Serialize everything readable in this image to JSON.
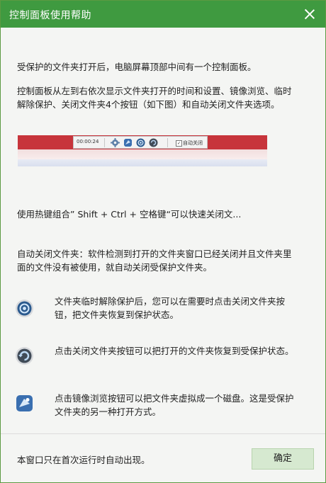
{
  "window": {
    "title": "控制面板使用帮助"
  },
  "content": {
    "intro": "受保护的文件夹打开后，电脑屏幕顶部中间有一个控制面板。",
    "panel_desc_line1": "控制面板从左到右依次显示文件夹打开的时间和设置、镜像浏览、临时",
    "panel_desc_line2": "解除保护、关闭文件夹4个按钮（如下图）和自动关闭文件夹选项。",
    "preview": {
      "time": "00:00:24",
      "checkbox_checked": true,
      "checkbox_label": "自动关闭"
    },
    "hotkey": "使用热键组合” Shift + Ctrl + 空格键“可以快速关闭文...",
    "autoclose_line1": "自动关闭文件夹：软件检测到打开的文件夹窗口已经关闭并且文件夹里",
    "autoclose_line2": "面的文件没有被使用，就自动关闭受保护文件夹。",
    "items": [
      {
        "icon": "unprotect-icon",
        "line1": "文件夹临时解除保护后，您可以在需要时点击关闭文件夹按",
        "line2": "钮，把文件夹恢复到保护状态。"
      },
      {
        "icon": "close-folder-icon",
        "line1": "点击关闭文件夹按钮可以把打开的文件夹恢复到受保护状态。",
        "line2": ""
      },
      {
        "icon": "mirror-browse-icon",
        "line1": "点击镜像浏览按钮可以把文件夹虚拟成一个磁盘。这是受保护",
        "line2": "文件夹的另一种打开方式。"
      }
    ]
  },
  "footer": {
    "note": "本窗口只在首次运行时自动出现。",
    "ok_label": "确定"
  },
  "colors": {
    "titlebar": "#3f9a40",
    "button": "#d6e9d0",
    "preview_red": "#c7343b"
  }
}
